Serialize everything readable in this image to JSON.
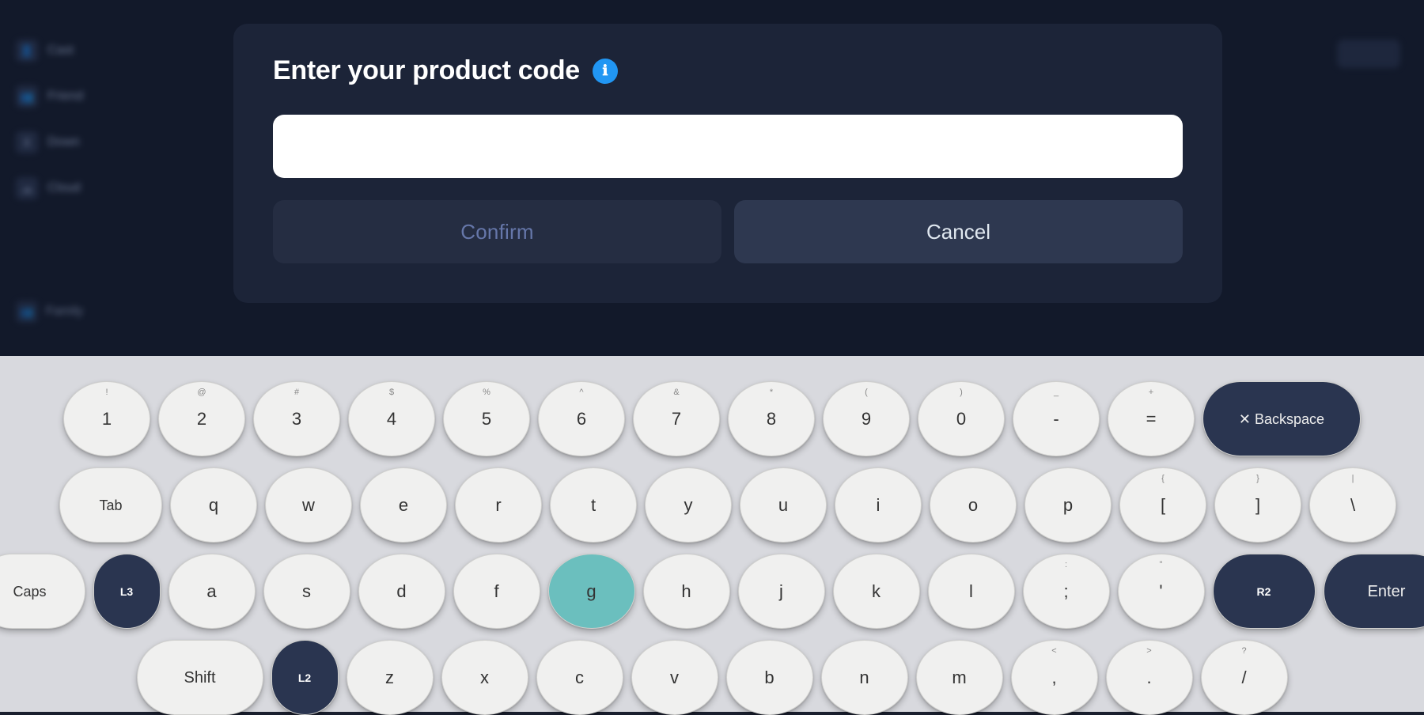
{
  "dialog": {
    "title": "Enter your product code",
    "info_icon": "ℹ",
    "input_placeholder": "",
    "confirm_label": "Confirm",
    "cancel_label": "Cancel"
  },
  "sidebar": {
    "items": [
      {
        "icon": "👤",
        "label": "Cast"
      },
      {
        "icon": "👥",
        "label": "Friend"
      },
      {
        "icon": "⬇",
        "label": "Down"
      },
      {
        "icon": "☁",
        "label": "Cloud"
      },
      {
        "icon": "👥",
        "label": "Family"
      }
    ]
  },
  "keyboard": {
    "row1": [
      {
        "main": "1",
        "shift": "!"
      },
      {
        "main": "2",
        "shift": "@"
      },
      {
        "main": "3",
        "shift": "#"
      },
      {
        "main": "4",
        "shift": "$"
      },
      {
        "main": "5",
        "shift": "%"
      },
      {
        "main": "6",
        "shift": "^"
      },
      {
        "main": "7",
        "shift": "&"
      },
      {
        "main": "8",
        "shift": "*"
      },
      {
        "main": "9",
        "shift": "("
      },
      {
        "main": "0",
        "shift": ")"
      },
      {
        "main": "-",
        "shift": "_"
      },
      {
        "main": "=",
        "shift": "+"
      },
      {
        "main": "Backspace",
        "shift": "X",
        "special": "backspace"
      }
    ],
    "row2": [
      {
        "main": "Tab",
        "special": "tab"
      },
      {
        "main": "q"
      },
      {
        "main": "w"
      },
      {
        "main": "e"
      },
      {
        "main": "r"
      },
      {
        "main": "t"
      },
      {
        "main": "y"
      },
      {
        "main": "u"
      },
      {
        "main": "i"
      },
      {
        "main": "o"
      },
      {
        "main": "p"
      },
      {
        "main": "[",
        "shift": "{"
      },
      {
        "main": "]",
        "shift": "}"
      },
      {
        "main": "\\",
        "shift": "|"
      }
    ],
    "row3": [
      {
        "main": "Caps",
        "special": "caps"
      },
      {
        "main": "L3",
        "special": "l3"
      },
      {
        "main": "a"
      },
      {
        "main": "s"
      },
      {
        "main": "d"
      },
      {
        "main": "f"
      },
      {
        "main": "g",
        "highlighted": true
      },
      {
        "main": "h"
      },
      {
        "main": "j"
      },
      {
        "main": "k"
      },
      {
        "main": "l"
      },
      {
        "main": ";",
        "shift": ":"
      },
      {
        "main": "'",
        "shift": "\""
      },
      {
        "main": "R2",
        "special": "r2"
      },
      {
        "main": "Enter",
        "special": "enter"
      }
    ],
    "row4": [
      {
        "main": "Shift",
        "special": "shift"
      },
      {
        "main": "L2",
        "special": "l2"
      },
      {
        "main": "z"
      },
      {
        "main": "x"
      },
      {
        "main": "c"
      },
      {
        "main": "v"
      },
      {
        "main": "b"
      },
      {
        "main": "n"
      },
      {
        "main": "m"
      },
      {
        "main": "<",
        "shift": ","
      },
      {
        "main": ">",
        "shift": "."
      },
      {
        "main": "?",
        "shift": "/"
      }
    ]
  }
}
